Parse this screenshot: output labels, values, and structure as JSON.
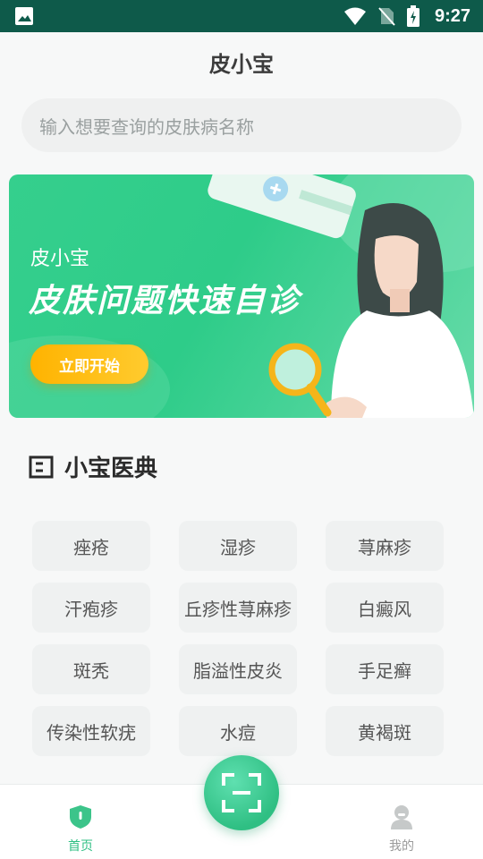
{
  "status_bar": {
    "time": "9:27",
    "icons": [
      "image-icon",
      "wifi-icon",
      "no-sim-icon",
      "battery-icon"
    ]
  },
  "app": {
    "title": "皮小宝"
  },
  "search": {
    "placeholder": "输入想要查询的皮肤病名称"
  },
  "banner": {
    "subtitle": "皮小宝",
    "title": "皮肤问题快速自诊",
    "button_label": "立即开始"
  },
  "section": {
    "title": "小宝医典",
    "icon": "book-icon"
  },
  "diseases": [
    "痤疮",
    "湿疹",
    "荨麻疹",
    "汗疱疹",
    "丘疹性荨麻疹",
    "白癜风",
    "斑秃",
    "脂溢性皮炎",
    "手足癣",
    "传染性软疣",
    "水痘",
    "黄褐斑"
  ],
  "tabbar": {
    "home_label": "首页",
    "mine_label": "我的",
    "scan_icon": "scan-icon"
  },
  "colors": {
    "status_bar": "#0e5a4a",
    "accent": "#2fbf83",
    "banner_button": "#ffbf1f"
  }
}
